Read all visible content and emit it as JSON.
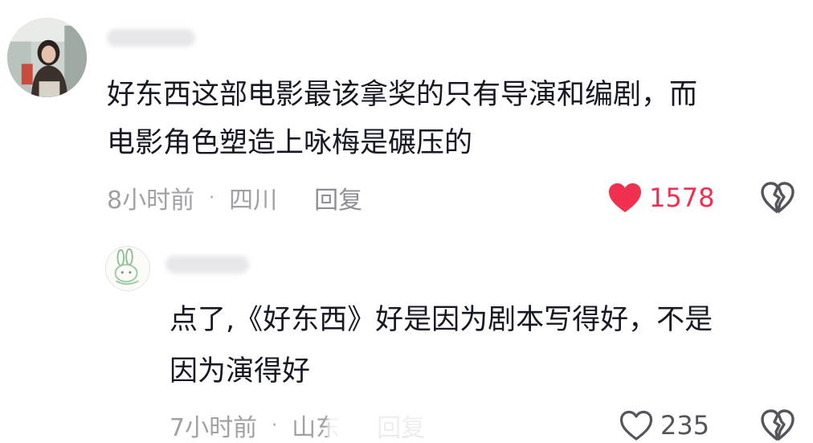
{
  "comments": [
    {
      "text_lines": [
        "好东西这部电影最该拿奖的只有导演和编剧，而",
        "电影角色塑造上咏梅是碾压的"
      ],
      "time": "8小时前",
      "location": "四川",
      "reply_label": "回复",
      "like_count": "1578",
      "liked": true,
      "like_color": "#f0304f"
    },
    {
      "text_lines": [
        "点了,《好东西》好是因为剧本写得好，不是",
        "因为演得好"
      ],
      "time": "7小时前",
      "location": "山东",
      "reply_label": "回复",
      "like_count": "235",
      "liked": false
    }
  ],
  "separator": "·",
  "icons": {
    "like_filled": "heart-filled-icon",
    "like_outline": "heart-outline-icon",
    "dislike": "broken-heart-icon"
  }
}
